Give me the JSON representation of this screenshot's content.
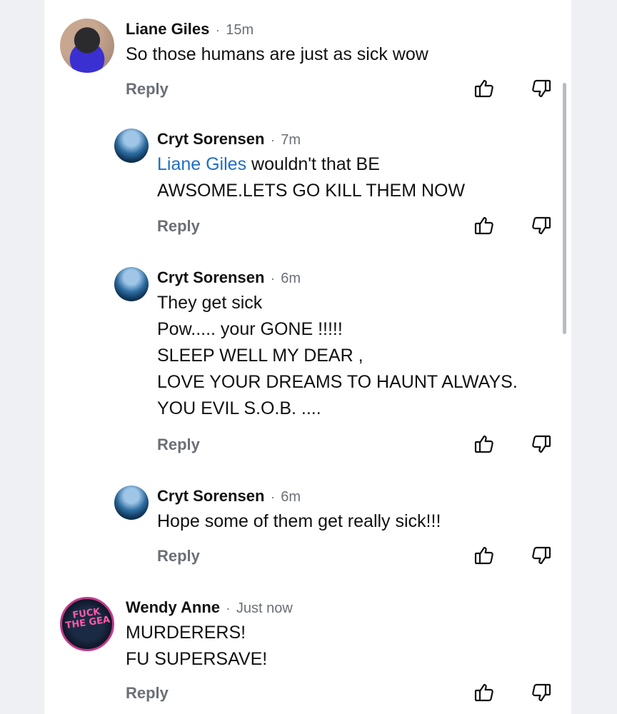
{
  "comments": [
    {
      "author": "Liane Giles",
      "sep": "·",
      "time": "15m",
      "mention": "",
      "lines": [
        "So those humans are just as sick wow"
      ],
      "reply_label": "Reply"
    },
    {
      "author": "Cryt Sorensen",
      "sep": "·",
      "time": "7m",
      "mention": "Liane Giles",
      "lines": [
        " wouldn't that BE",
        "AWSOME.LETS GO KILL THEM NOW"
      ],
      "reply_label": "Reply"
    },
    {
      "author": "Cryt Sorensen",
      "sep": "·",
      "time": "6m",
      "mention": "",
      "lines": [
        "They get sick",
        "Pow..... your GONE !!!!!",
        "SLEEP WELL MY DEAR ,",
        "LOVE YOUR DREAMS TO HAUNT ALWAYS.",
        "YOU EVIL S.O.B. ...."
      ],
      "reply_label": "Reply"
    },
    {
      "author": "Cryt Sorensen",
      "sep": "·",
      "time": "6m",
      "mention": "",
      "lines": [
        "Hope some of them get really sick!!!"
      ],
      "reply_label": "Reply"
    },
    {
      "author": "Wendy Anne",
      "sep": "·",
      "time": "Just now",
      "mention": "",
      "lines": [
        "MURDERERS!",
        "FU SUPERSAVE!"
      ],
      "reply_label": "Reply"
    }
  ],
  "avatar_badge_text": "FUCK THE GEA",
  "icons": {
    "like": "thumbs-up-icon",
    "dislike": "thumbs-down-icon"
  },
  "colors": {
    "mention": "#1f6fc4",
    "meta": "#6b6f76",
    "text": "#111111"
  }
}
